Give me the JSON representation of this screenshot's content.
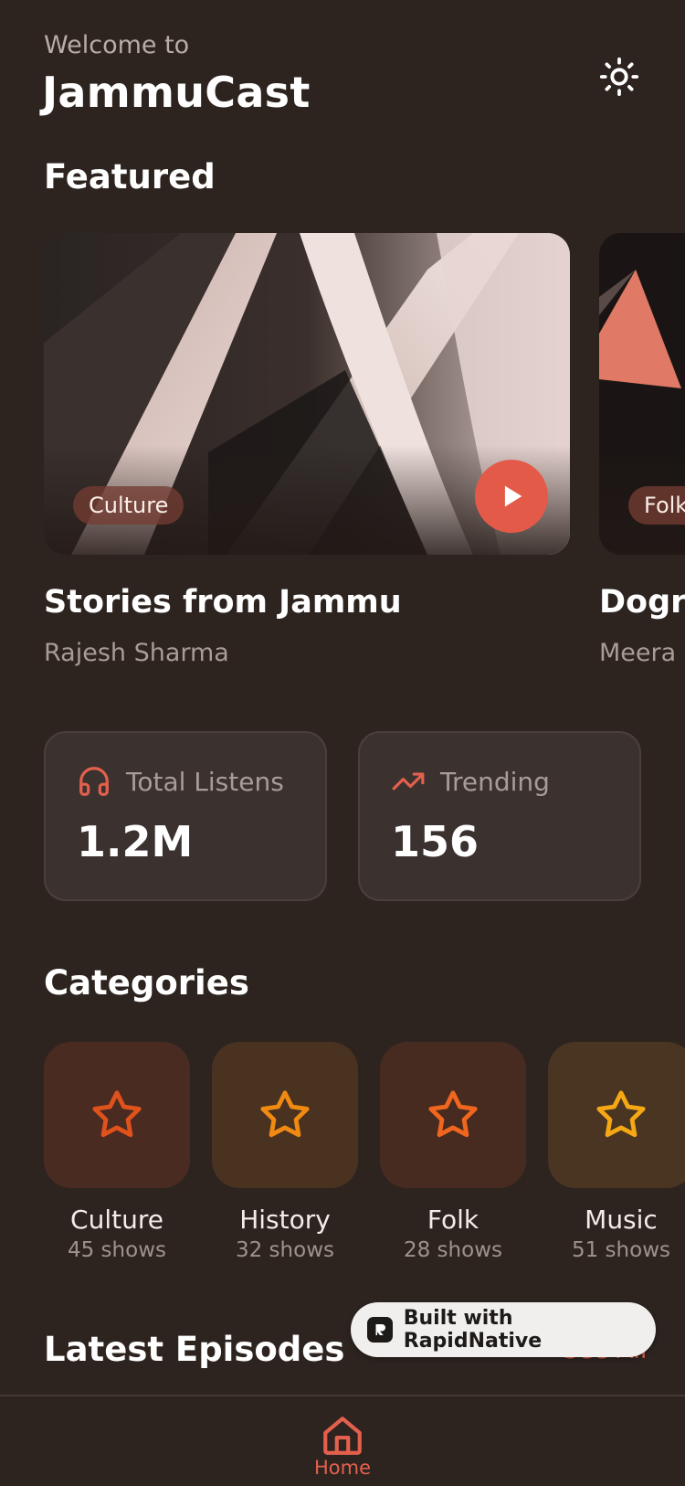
{
  "header": {
    "welcome_text": "Welcome to",
    "app_name": "JammuCast"
  },
  "featured": {
    "title": "Featured",
    "items": [
      {
        "tag": "Culture",
        "title": "Stories from Jammu",
        "author": "Rajesh Sharma"
      },
      {
        "tag": "Folk",
        "title": "Dogri",
        "author": "Meera"
      }
    ]
  },
  "stats": [
    {
      "label": "Total Listens",
      "value": "1.2M",
      "icon": "headphones-icon"
    },
    {
      "label": "Trending",
      "value": "156",
      "icon": "trending-up-icon"
    }
  ],
  "categories": {
    "title": "Categories",
    "items": [
      {
        "name": "Culture",
        "count": "45 shows",
        "tile_color": "#4a2b22",
        "star_color": "#e0521c"
      },
      {
        "name": "History",
        "count": "32 shows",
        "tile_color": "#4a3220",
        "star_color": "#f08a12"
      },
      {
        "name": "Folk",
        "count": "28 shows",
        "tile_color": "#472b20",
        "star_color": "#f0661e"
      },
      {
        "name": "Music",
        "count": "51 shows",
        "tile_color": "#4a3522",
        "star_color": "#f5a714"
      }
    ]
  },
  "latest": {
    "title": "Latest Episodes",
    "see_all": "See All"
  },
  "badge": {
    "text": "Built with RapidNative"
  },
  "nav": {
    "home_label": "Home"
  },
  "colors": {
    "background": "#2d2420",
    "accent": "#e45a48",
    "card": "#3b3230"
  }
}
